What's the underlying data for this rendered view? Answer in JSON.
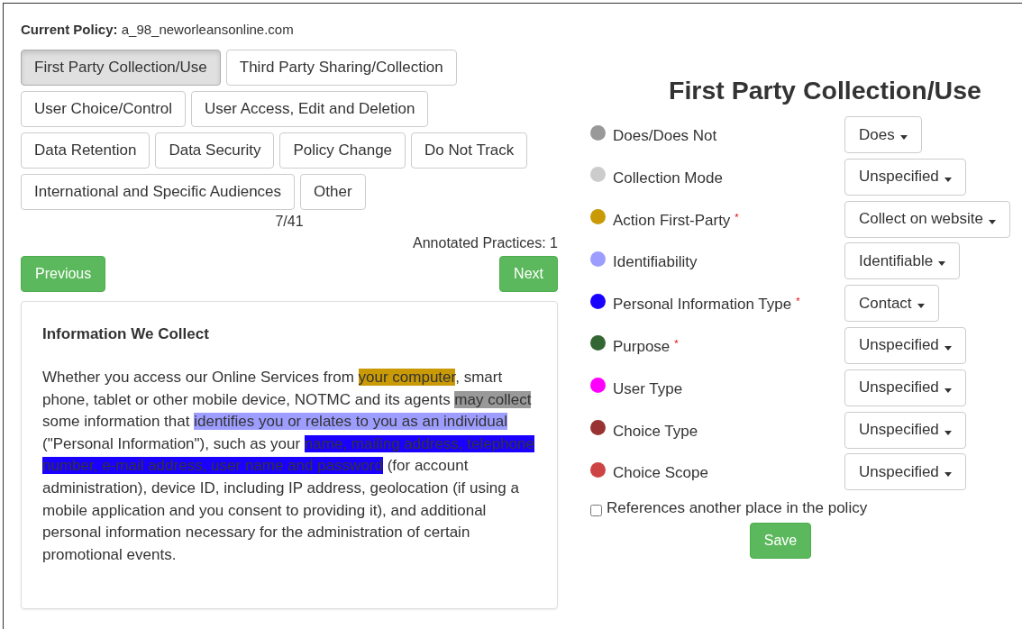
{
  "policy": {
    "label": "Current Policy:",
    "name": "a_98_neworleansonline.com"
  },
  "categories": [
    {
      "label": "First Party Collection/Use",
      "selected": true
    },
    {
      "label": "Third Party Sharing/Collection",
      "selected": false
    },
    {
      "label": "User Choice/Control",
      "selected": false
    },
    {
      "label": "User Access, Edit and Deletion",
      "selected": false
    },
    {
      "label": "Data Retention",
      "selected": false
    },
    {
      "label": "Data Security",
      "selected": false
    },
    {
      "label": "Policy Change",
      "selected": false
    },
    {
      "label": "Do Not Track",
      "selected": false
    },
    {
      "label": "International and Specific Audiences",
      "selected": false
    },
    {
      "label": "Other",
      "selected": false
    }
  ],
  "counter": "7/41",
  "annotated": "Annotated Practices: 1",
  "nav": {
    "previous": "Previous",
    "next": "Next"
  },
  "segment": {
    "heading": "Information We Collect",
    "text": [
      {
        "text": "Whether you access our Online Services from "
      },
      {
        "text": "your computer",
        "color": "#c99a06"
      },
      {
        "text": ", smart phone, tablet or other mobile device, NOTMC and its agents "
      },
      {
        "text": "may collect",
        "color": "#999999"
      },
      {
        "text": " some information that "
      },
      {
        "text": "identifies you or relates to you as an individual",
        "color": "#9d9dff"
      },
      {
        "text": " (\"Personal Information\"), such as your "
      },
      {
        "text": "name, mailing address, telephone number, e-mail address, user name and password",
        "color": "#1a00ff"
      },
      {
        "text": " (for account administration), device ID, including IP address, geolocation (if using a mobile application and you consent to providing it), and additional personal information necessary for the administration of certain promotional events."
      }
    ]
  },
  "form": {
    "title": "First Party Collection/Use",
    "attributes": [
      {
        "label": "Does/Does Not",
        "color": "#999999",
        "value": "Does"
      },
      {
        "label": "Collection Mode",
        "color": "#cccccc",
        "value": "Unspecified"
      },
      {
        "label": "Action First-Party",
        "color": "#c99a06",
        "mark": "*",
        "value": "Collect on website"
      },
      {
        "label": "Identifiability",
        "color": "#9d9dff",
        "value": "Identifiable"
      },
      {
        "label": "Personal Information Type",
        "color": "#1a00ff",
        "mark": "*",
        "value": "Contact"
      },
      {
        "label": "Purpose",
        "color": "#336633",
        "mark": "*",
        "value": "Unspecified"
      },
      {
        "label": "User Type",
        "color": "#ff00ff",
        "value": "Unspecified"
      },
      {
        "label": "Choice Type",
        "color": "#993333",
        "value": "Unspecified"
      },
      {
        "label": "Choice Scope",
        "color": "#cc4444",
        "value": "Unspecified"
      }
    ],
    "reference": {
      "label": "References another place in the policy",
      "checked": false
    },
    "save": "Save"
  }
}
